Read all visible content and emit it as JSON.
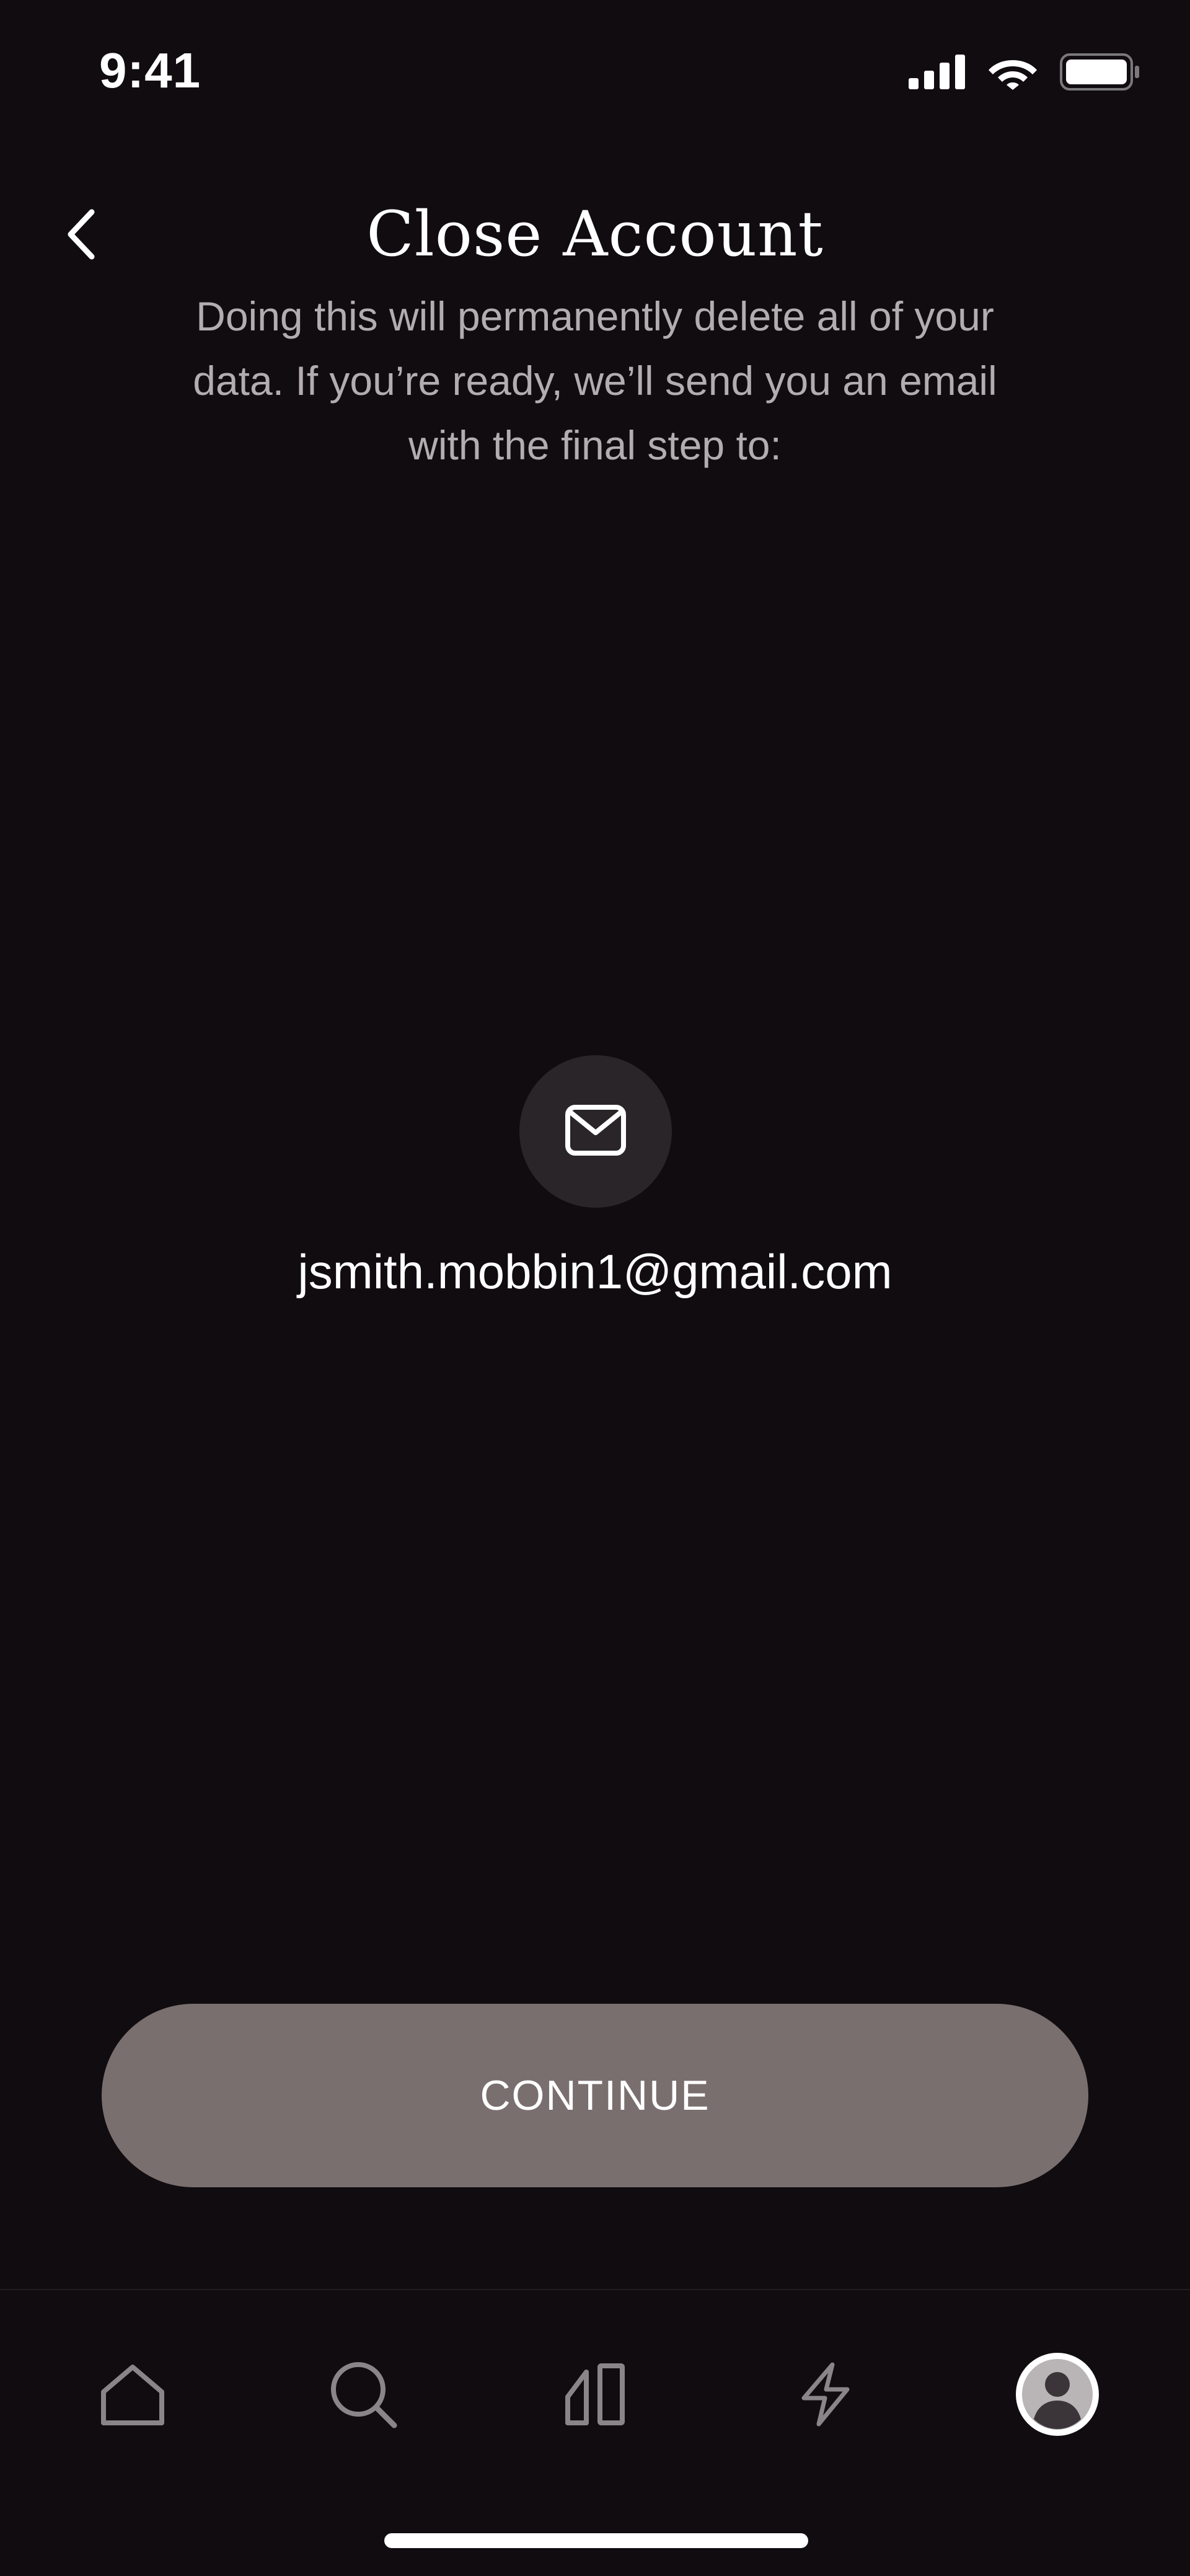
{
  "status_bar": {
    "time": "9:41",
    "icons": [
      "cellular-signal-icon",
      "wifi-icon",
      "battery-icon"
    ]
  },
  "header": {
    "back_icon": "chevron-left-icon",
    "title": "Close Account"
  },
  "description": "Doing this will permanently delete all of your data. If you’re ready, we’ll send you an email with the final step to:",
  "email": {
    "icon": "envelope-icon",
    "address": "jsmith.mobbin1@gmail.com"
  },
  "continue_button": {
    "label": "CONTINUE"
  },
  "tab_bar": {
    "items": [
      {
        "name": "home",
        "icon": "home-icon",
        "active": false
      },
      {
        "name": "search",
        "icon": "search-icon",
        "active": false
      },
      {
        "name": "library",
        "icon": "library-icon",
        "active": false
      },
      {
        "name": "activity",
        "icon": "lightning-icon",
        "active": false
      },
      {
        "name": "profile",
        "icon": "profile-avatar-icon",
        "active": true
      }
    ]
  },
  "colors": {
    "background": "#100c0f",
    "text_primary": "#ffffff",
    "text_secondary": "#b3adb1",
    "button_fill": "#7a6f6f",
    "badge_fill": "#2a2529",
    "tab_inactive": "#8a8588"
  }
}
